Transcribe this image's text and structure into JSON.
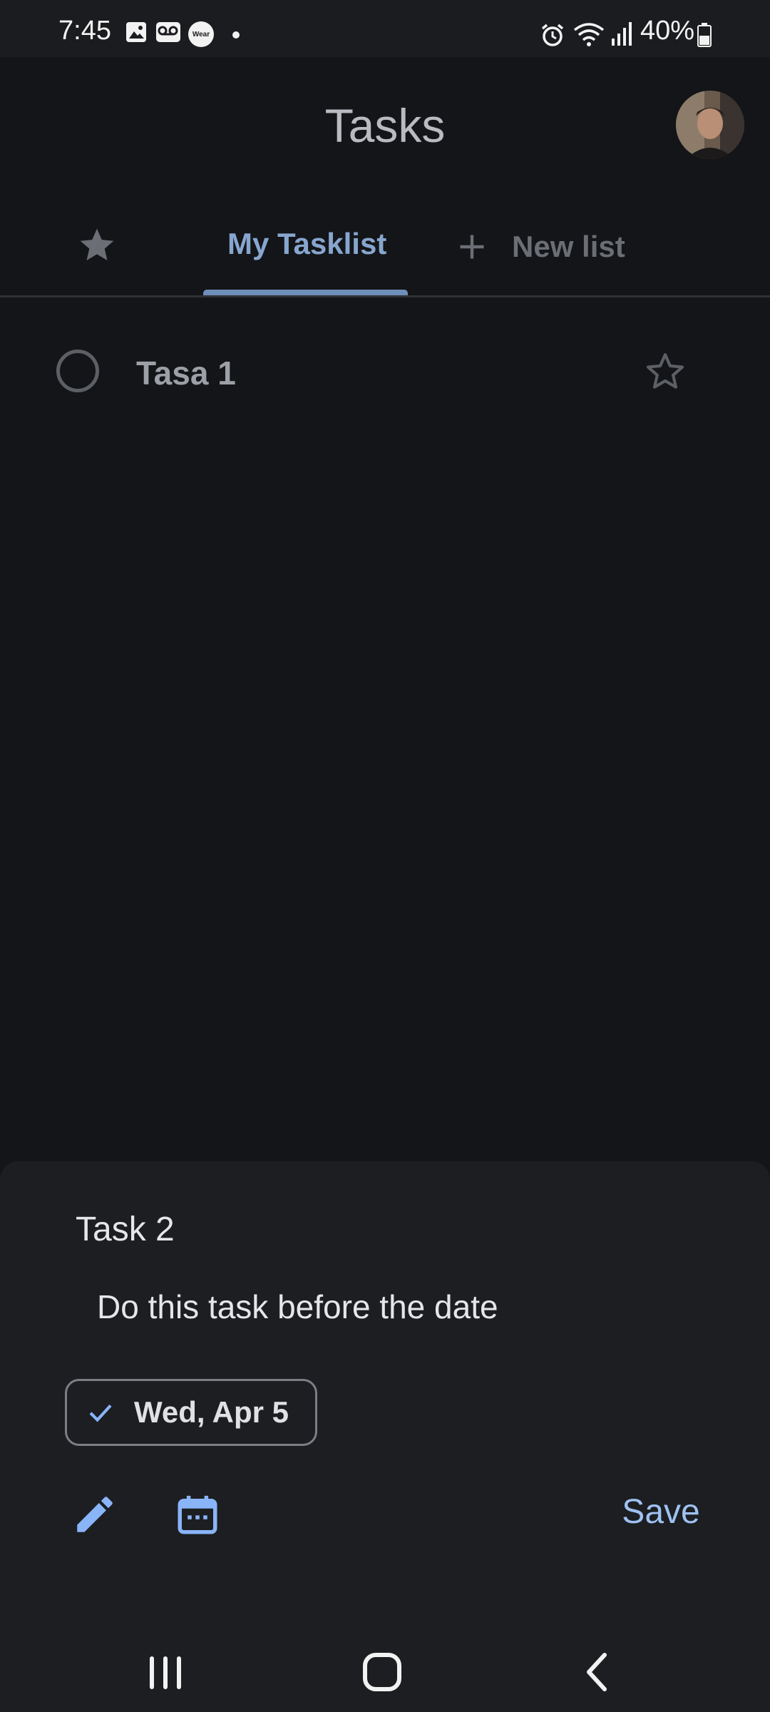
{
  "status_bar": {
    "time": "7:45",
    "left_icons": [
      "gallery-icon",
      "voicemail-icon",
      "wear-icon",
      "dot-icon"
    ],
    "wear_label": "Wear",
    "right_icons": [
      "alarm-icon",
      "wifi-icon",
      "signal-icon",
      "battery-icon"
    ],
    "battery": "40%"
  },
  "app_bar": {
    "title": "Tasks",
    "avatar": "user-avatar"
  },
  "tabs": {
    "starred_icon": "star-icon",
    "active": "My Tasklist",
    "new_list": "New list"
  },
  "tasks": [
    {
      "title": "Tasa 1",
      "completed": false,
      "starred": false
    }
  ],
  "sheet": {
    "title": "Task 2",
    "description": "Do this task before the date",
    "date_chip": "Wed, Apr 5",
    "save": "Save",
    "accent_color": "#9ec1f1"
  },
  "nav": {
    "buttons": [
      "recent-apps-icon",
      "home-icon",
      "back-icon"
    ]
  }
}
